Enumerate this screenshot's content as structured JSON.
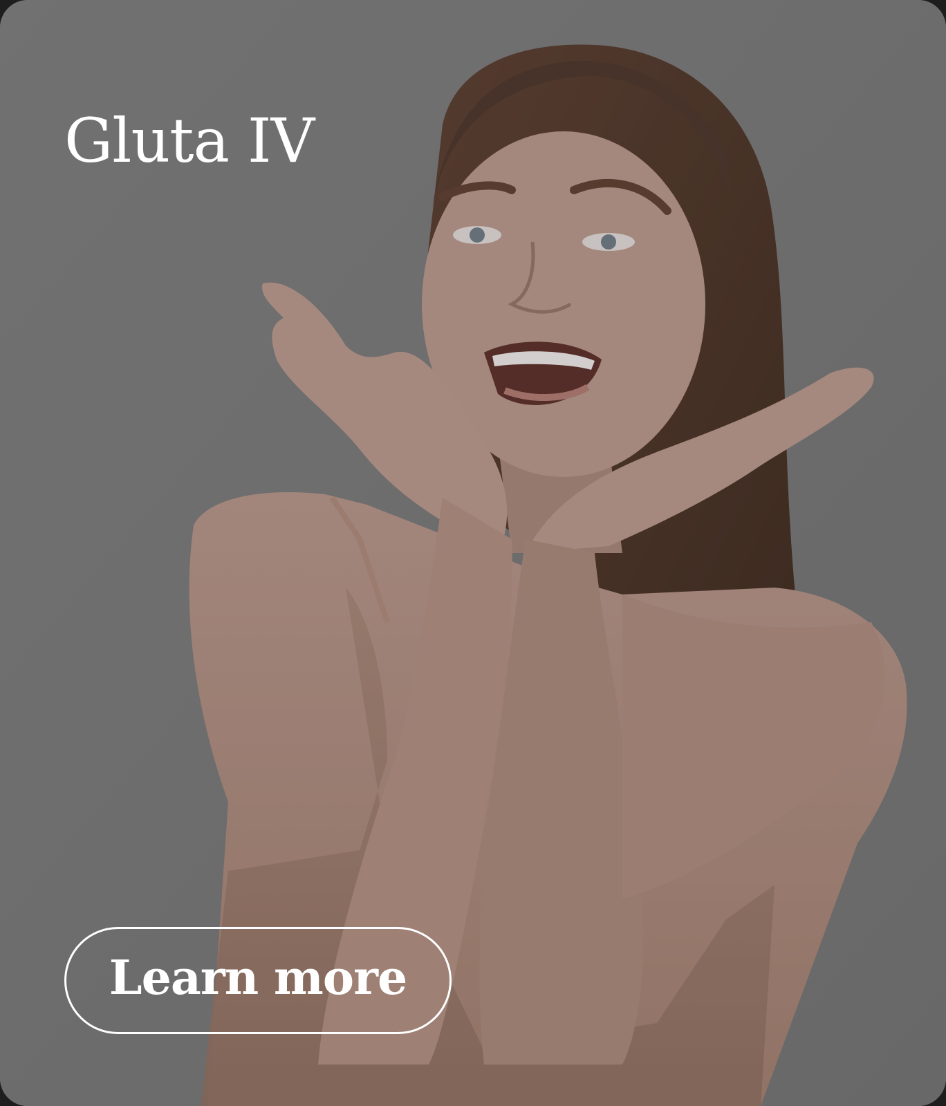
{
  "card": {
    "title": "Gluta IV",
    "cta_label": "Learn more",
    "colors": {
      "overlay": "#767676",
      "text": "#ffffff",
      "skin": "#b08a78",
      "hair": "#4a3228",
      "dress": "#a88878"
    }
  }
}
